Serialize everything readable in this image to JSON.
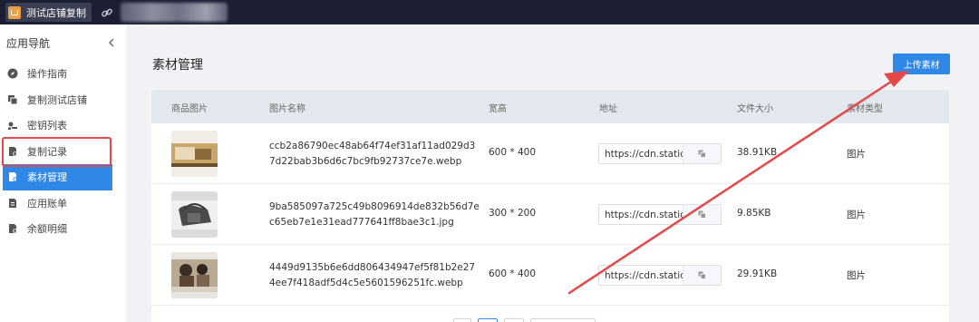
{
  "topbar": {
    "store_name": "测试店铺复制"
  },
  "sidebar": {
    "title": "应用导航",
    "items": [
      {
        "label": "操作指南",
        "icon": "compass-icon"
      },
      {
        "label": "复制测试店铺",
        "icon": "copy-store-icon"
      },
      {
        "label": "密钥列表",
        "icon": "key-icon"
      },
      {
        "label": "复制记录",
        "icon": "record-icon"
      },
      {
        "label": "素材管理",
        "icon": "material-icon",
        "active": true
      },
      {
        "label": "应用账单",
        "icon": "bill-icon"
      },
      {
        "label": "余额明细",
        "icon": "balance-icon"
      }
    ]
  },
  "main": {
    "title": "素材管理",
    "upload_label": "上传素材"
  },
  "table": {
    "headers": [
      "商品图片",
      "图片名称",
      "宽高",
      "地址",
      "文件大小",
      "素材类型"
    ],
    "rows": [
      {
        "name": "ccb2a86790ec48ab64f74ef31af11ad029d37d22bab3b6d6c7bc9fb92737ce7e.webp",
        "dims": "600 * 400",
        "url": "https://cdn.static",
        "size": "38.91KB",
        "type": "图片"
      },
      {
        "name": "9ba585097a725c49b8096914de832b56d7ec65eb7e1e31ead777641ff8bae3c1.jpg",
        "dims": "300 * 200",
        "url": "https://cdn.static",
        "size": "9.85KB",
        "type": "图片"
      },
      {
        "name": "4449d9135b6e6dd806434947ef5f81b2e274ee7f418adf5d4c5e5601596251fc.webp",
        "dims": "600 * 400",
        "url": "https://cdn.static",
        "size": "29.91KB",
        "type": "图片"
      }
    ]
  },
  "colors": {
    "accent": "#2f88e6",
    "topbar": "#1c1f33",
    "annotation": "#e44848"
  }
}
